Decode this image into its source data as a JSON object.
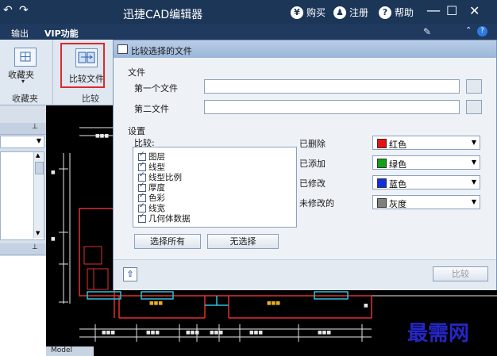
{
  "app": {
    "title": "迅捷CAD编辑器",
    "buy_label": "购买",
    "register_label": "注册",
    "help_label": "帮助",
    "buy_glyph": "¥",
    "register_glyph": "♟",
    "help_glyph": "?",
    "minimize_glyph": "—",
    "maximize_glyph": "☐",
    "close_glyph": "✕"
  },
  "menubar": {
    "items": [
      "输出",
      "VIP功能"
    ]
  },
  "ribbon": {
    "favorites_label": "收藏夹",
    "favorites_group": "收藏夹",
    "compare_label": "比较文件",
    "compare_group": "比较"
  },
  "dialog": {
    "title": "比较选择的文件",
    "files_section": "文件",
    "first_file_label": "第一个文件",
    "second_file_label": "第二文件",
    "first_file_value": "",
    "second_file_value": "",
    "settings_section": "设置",
    "compare_label": "比较:",
    "checks": [
      {
        "label": "图层",
        "checked": true
      },
      {
        "label": "线型",
        "checked": true
      },
      {
        "label": "线型比例",
        "checked": true
      },
      {
        "label": "厚度",
        "checked": true
      },
      {
        "label": "色彩",
        "checked": true
      },
      {
        "label": "线宽",
        "checked": true
      },
      {
        "label": "几何体数据",
        "checked": true
      }
    ],
    "select_all_label": "选择所有",
    "select_none_label": "无选择",
    "colors": [
      {
        "label": "已删除",
        "color_name": "红色",
        "swatch": "#e81010"
      },
      {
        "label": "已添加",
        "color_name": "绿色",
        "swatch": "#14a014"
      },
      {
        "label": "已修改",
        "color_name": "蓝色",
        "swatch": "#1030e0"
      },
      {
        "label": "未修改的",
        "color_name": "灰度",
        "swatch": "#808080"
      }
    ],
    "compare_button": "比较"
  },
  "canvas": {
    "model_tab": "Model"
  },
  "watermark": "最需网",
  "accent_colors": {
    "titlebar": "#1c3658",
    "highlight": "#e02828",
    "cad_background": "#000000"
  }
}
